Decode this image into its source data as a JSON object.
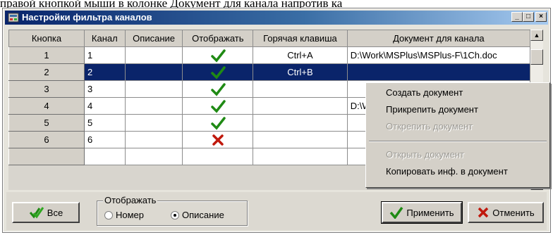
{
  "background_text": "правой кнопкой мыши в колонке Документ для канала напротив ка",
  "window": {
    "title": "Настройки фильтра каналов",
    "controls": [
      "_",
      "□",
      "×"
    ]
  },
  "grid": {
    "columns": [
      "Кнопка",
      "Канал",
      "Описание",
      "Отображать",
      "Горячая клавиша",
      "Документ для канала"
    ],
    "rows": [
      {
        "button": "1",
        "channel": "1",
        "description": "",
        "display": "check",
        "hotkey": "Ctrl+A",
        "document": "D:\\Work\\MSPlus\\MSPlus-F\\1Ch.doc"
      },
      {
        "button": "2",
        "channel": "2",
        "description": "",
        "display": "check",
        "hotkey": "Ctrl+B",
        "document": "",
        "selected": true
      },
      {
        "button": "3",
        "channel": "3",
        "description": "",
        "display": "check",
        "hotkey": "",
        "document": ""
      },
      {
        "button": "4",
        "channel": "4",
        "description": "",
        "display": "check",
        "hotkey": "",
        "document": "D:\\W"
      },
      {
        "button": "5",
        "channel": "5",
        "description": "",
        "display": "check",
        "hotkey": "",
        "document": ""
      },
      {
        "button": "6",
        "channel": "6",
        "description": "",
        "display": "cross",
        "hotkey": "",
        "document": ""
      }
    ]
  },
  "context_menu": {
    "items": [
      {
        "label": "Создать документ",
        "enabled": true
      },
      {
        "label": "Прикрепить документ",
        "enabled": true
      },
      {
        "label": "Открепить документ",
        "enabled": false
      },
      {
        "label": "Открыть документ",
        "enabled": false
      },
      {
        "label": "Копировать инф. в документ",
        "enabled": true
      }
    ]
  },
  "bottom": {
    "all_button": "Все",
    "display_group": {
      "legend": "Отображать",
      "options": [
        "Номер",
        "Описание"
      ],
      "selected": "Описание"
    },
    "apply_button": "Применить",
    "cancel_button": "Отменить"
  },
  "colors": {
    "selection": "#0a246a",
    "check": "#1f8a14",
    "cross": "#c0180c",
    "title_start": "#08246b",
    "title_end": "#a6caf0"
  }
}
